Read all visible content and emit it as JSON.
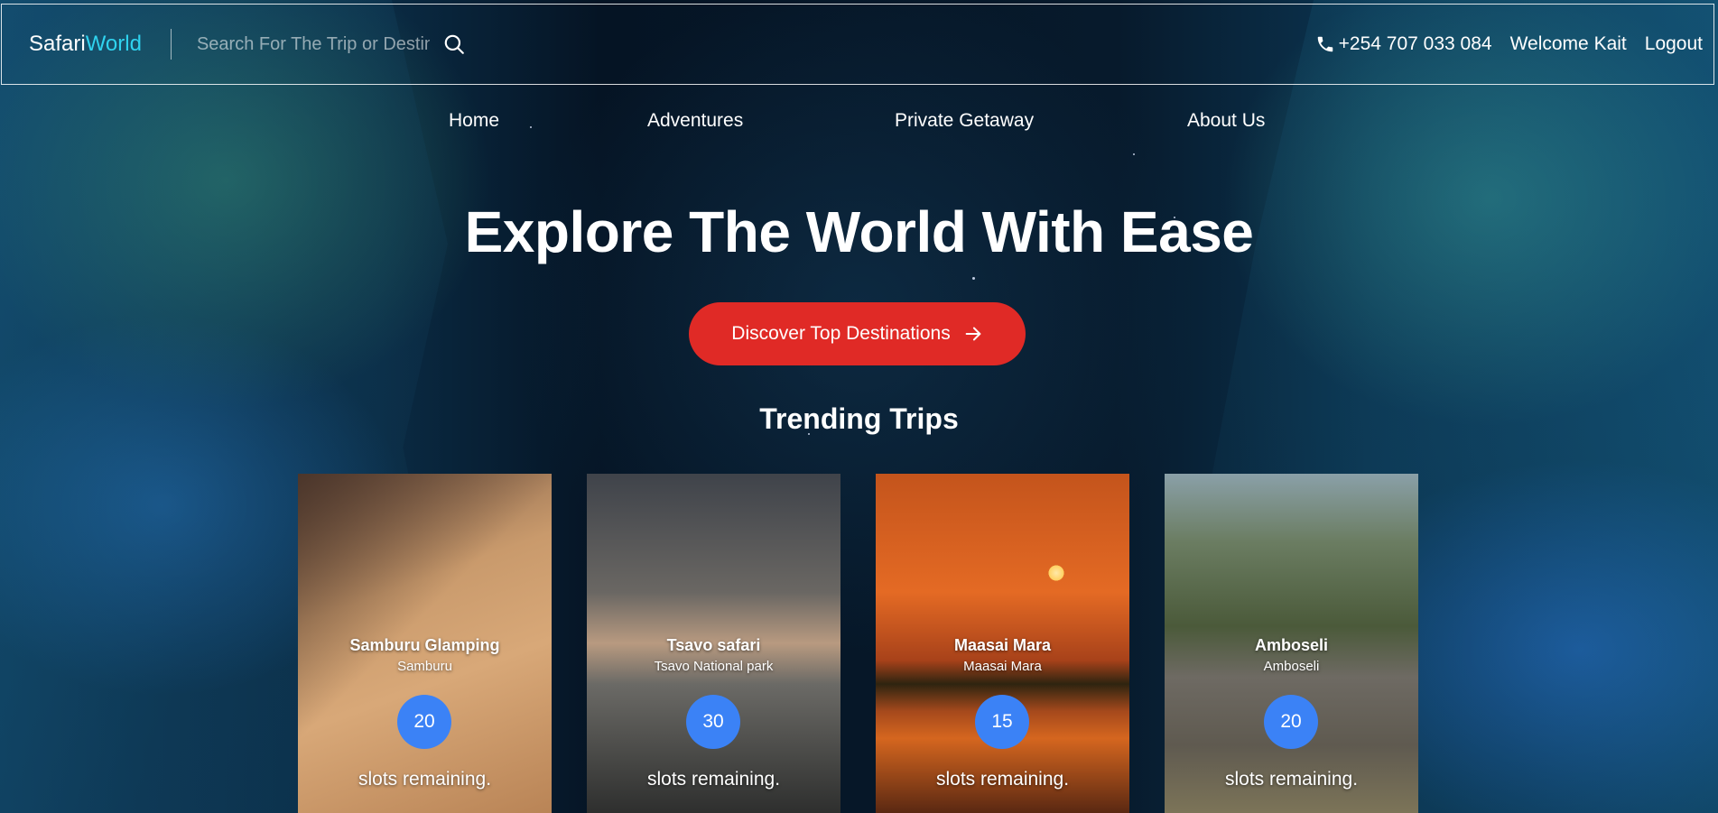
{
  "header": {
    "logo_part1": "Safari",
    "logo_part2": "World",
    "search_placeholder": "Search For The Trip or Destination",
    "search_icon": "search-icon",
    "phone": "+254 707 033 084",
    "phone_icon": "phone-icon",
    "welcome": "Welcome Kait",
    "logout": "Logout"
  },
  "nav": {
    "items": [
      "Home",
      "Adventures",
      "Private Getaway",
      "About Us"
    ]
  },
  "hero": {
    "title": "Explore The World With Ease",
    "cta_label": "Discover Top Destinations",
    "cta_icon": "arrow-right-icon",
    "cta_color": "#e02a26"
  },
  "trending": {
    "title": "Trending Trips",
    "badge_color": "#3b82f6",
    "cards": [
      {
        "title": "Samburu Glamping",
        "location": "Samburu",
        "slots": "20",
        "slots_label": "slots remaining."
      },
      {
        "title": "Tsavo safari",
        "location": "Tsavo National park",
        "slots": "30",
        "slots_label": "slots remaining."
      },
      {
        "title": "Maasai Mara",
        "location": "Maasai Mara",
        "slots": "15",
        "slots_label": "slots remaining."
      },
      {
        "title": "Amboseli",
        "location": "Amboseli",
        "slots": "20",
        "slots_label": "slots remaining."
      }
    ]
  }
}
